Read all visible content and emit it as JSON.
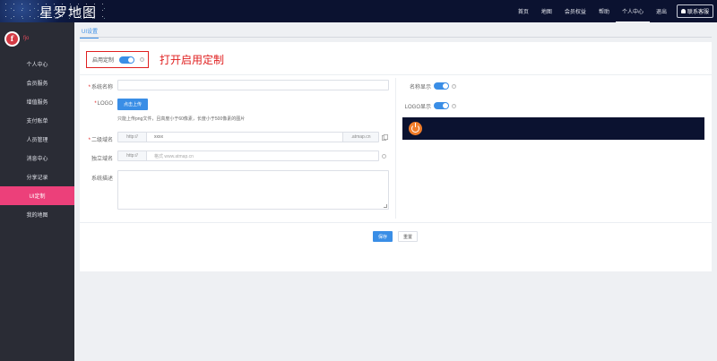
{
  "header": {
    "site_title": "星罗地图",
    "nav": [
      {
        "label": "首页"
      },
      {
        "label": "地图"
      },
      {
        "label": "会员权益"
      },
      {
        "label": "帮助"
      },
      {
        "label": "个人中心"
      },
      {
        "label": "退出"
      }
    ],
    "active_nav": "个人中心",
    "contact_label": "联系客服"
  },
  "sidebar": {
    "avatar_letter": "f",
    "username": "fjo",
    "items": [
      {
        "label": "个人中心"
      },
      {
        "label": "会员服务"
      },
      {
        "label": "增值服务"
      },
      {
        "label": "支付账单"
      },
      {
        "label": "人员管理"
      },
      {
        "label": "消息中心"
      },
      {
        "label": "分享记录"
      },
      {
        "label": "UI定制"
      },
      {
        "label": "我的地图"
      }
    ],
    "active_item": "UI定制"
  },
  "tabs": [
    {
      "label": "UI设置"
    }
  ],
  "form": {
    "enable_label": "启用定制",
    "enable_on": true,
    "annotation": "打开启用定制",
    "system_name": {
      "label": "系统名称",
      "value": ""
    },
    "logo": {
      "label": "LOGO",
      "upload_label": "点击上传",
      "tip": "只能上传png文件，且高度小于60像素，长度小于500像素的图片"
    },
    "domain": {
      "label": "二级域名",
      "prefix": "http://",
      "value": "xxxx",
      "suffix": ".atmap.cn"
    },
    "custom_domain": {
      "label": "独立域名",
      "prefix": "http://",
      "placeholder": "格式 www.atmap.cn"
    },
    "description": {
      "label": "系统描述"
    }
  },
  "right_panel": {
    "name_display_label": "名称显示",
    "name_display_on": true,
    "logo_display_label": "LOGO显示",
    "logo_display_on": true,
    "preview_bg": "#0b1230",
    "logo_color": "#f07c2a"
  },
  "buttons": {
    "save": "保存",
    "reset": "重置"
  }
}
